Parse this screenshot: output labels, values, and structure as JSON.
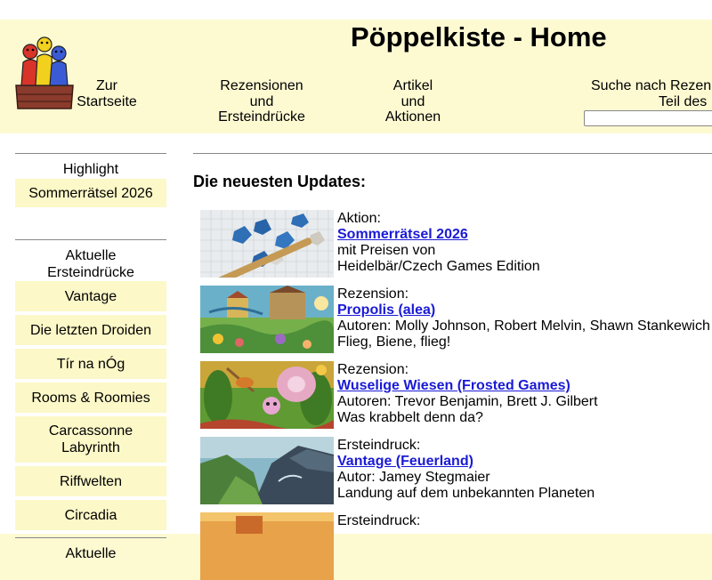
{
  "header": {
    "title": "Pöppelkiste - Home",
    "nav": [
      {
        "lines": [
          "Zur",
          "Startseite"
        ]
      },
      {
        "lines": [
          "Rezensionen",
          "und",
          "Ersteindrücke"
        ]
      },
      {
        "lines": [
          "Artikel",
          "und",
          "Aktionen"
        ]
      }
    ],
    "search": {
      "line1": "Suche nach Rezen",
      "line2": "Teil des",
      "value": ""
    }
  },
  "sidebar": {
    "highlight_heading": "Highlight",
    "highlight_items": [
      "Sommerrätsel 2026"
    ],
    "ersteindruecke_heading": [
      "Aktuelle",
      "Ersteindrücke"
    ],
    "ersteindruecke_items": [
      [
        "Vantage"
      ],
      [
        "Die letzten Droiden"
      ],
      [
        "Tír na nÓg"
      ],
      [
        "Rooms & Roomies"
      ],
      [
        "Carcassonne",
        "Labyrinth"
      ],
      [
        "Riffwelten"
      ],
      [
        "Circadia"
      ]
    ],
    "next_heading": [
      "Aktuelle"
    ]
  },
  "main": {
    "updates_title": "Die neuesten Updates:",
    "entries": [
      {
        "type": "Aktion:",
        "link": "Sommerrätsel 2026",
        "line3": "mit Preisen von",
        "line4": "Heidelbär/Czech Games Edition"
      },
      {
        "type": "Rezension:",
        "link": "Propolis (alea)",
        "line3": "Autoren: Molly Johnson, Robert Melvin, Shawn Stankewich",
        "line4": "Flieg, Biene, flieg!"
      },
      {
        "type": "Rezension:",
        "link": "Wuselige Wiesen (Frosted Games)",
        "line3": "Autoren: Trevor Benjamin, Brett J. Gilbert",
        "line4": "Was krabbelt denn da?"
      },
      {
        "type": "Ersteindruck:",
        "link": "Vantage (Feuerland)",
        "line3": "Autor: Jamey Stegmaier",
        "line4": "Landung auf dem unbekannten Planeten"
      },
      {
        "type": "Ersteindruck:",
        "link": "",
        "line3": "",
        "line4": ""
      }
    ]
  },
  "icons": [
    "logo-meeples-box",
    "dice-photo",
    "propolis-cover",
    "wuselige-wiesen-cover",
    "vantage-cover",
    "game-cover"
  ]
}
